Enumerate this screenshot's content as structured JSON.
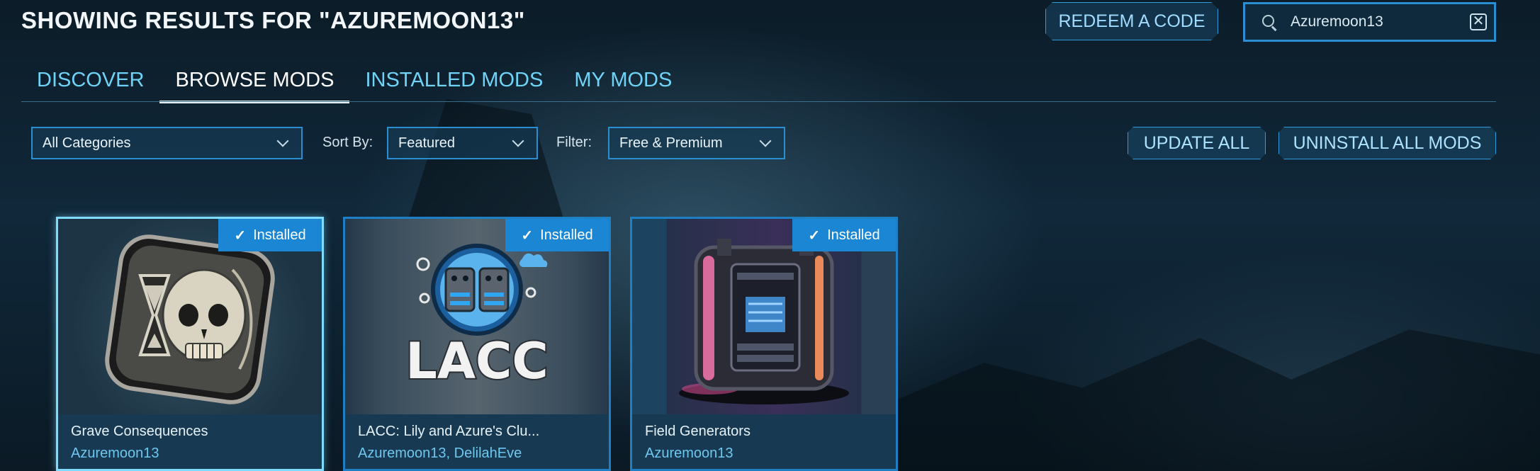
{
  "header": {
    "title": "SHOWING RESULTS FOR \"AZUREMOON13\"",
    "redeem_label": "REDEEM A CODE",
    "search_value": "Azuremoon13"
  },
  "tabs": [
    {
      "label": "DISCOVER",
      "active": false
    },
    {
      "label": "BROWSE MODS",
      "active": true
    },
    {
      "label": "INSTALLED MODS",
      "active": false
    },
    {
      "label": "MY MODS",
      "active": false
    }
  ],
  "filters": {
    "category_value": "All Categories",
    "sort_label": "Sort By:",
    "sort_value": "Featured",
    "filter_label": "Filter:",
    "filter_value": "Free & Premium"
  },
  "actions": {
    "update_all": "UPDATE ALL",
    "uninstall_all": "UNINSTALL ALL MODS"
  },
  "mods": [
    {
      "title": "Grave Consequences",
      "author": "Azuremoon13",
      "status": "Installed",
      "thumb_icon": "skull-hourglass-icon"
    },
    {
      "title": "LACC: Lily and Azure's Clu...",
      "author": "Azuremoon13, DelilahEve",
      "status": "Installed",
      "thumb_icon": "lacc-logo-icon",
      "thumb_text": "LACC"
    },
    {
      "title": "Field Generators",
      "author": "Azuremoon13",
      "status": "Installed",
      "thumb_icon": "field-generator-machine-icon"
    }
  ],
  "colors": {
    "accent": "#1a86d4",
    "tab_text": "#6fd3f7",
    "border": "#2b8ed0"
  }
}
